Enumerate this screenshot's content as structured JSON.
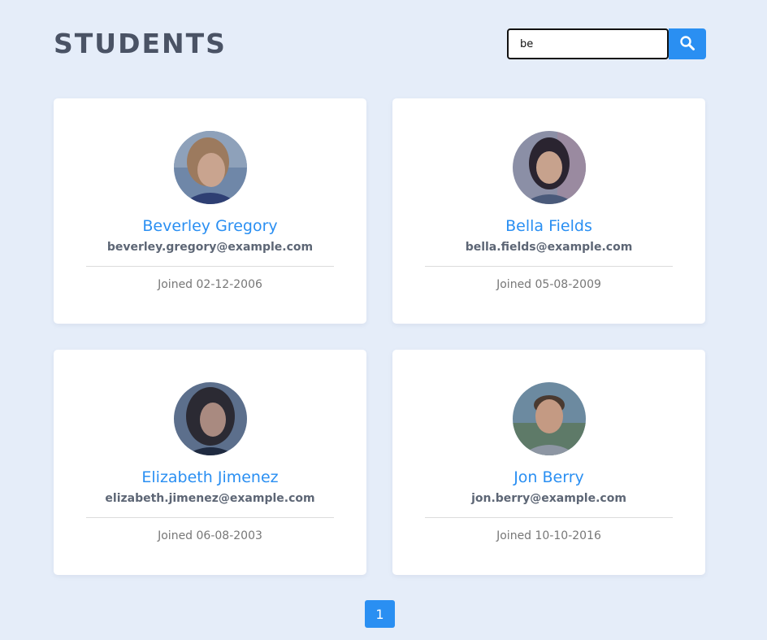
{
  "header": {
    "title": "STUDENTS"
  },
  "search": {
    "value": "be",
    "icon": "search-icon"
  },
  "students": [
    {
      "name": "Beverley Gregory",
      "email": "beverley.gregory@example.com",
      "joined": "Joined 02-12-2006"
    },
    {
      "name": "Bella Fields",
      "email": "bella.fields@example.com",
      "joined": "Joined 05-08-2009"
    },
    {
      "name": "Elizabeth Jimenez",
      "email": "elizabeth.jimenez@example.com",
      "joined": "Joined 06-08-2003"
    },
    {
      "name": "Jon Berry",
      "email": "jon.berry@example.com",
      "joined": "Joined 10-10-2016"
    }
  ],
  "pagination": {
    "pages": [
      "1"
    ],
    "current": "1"
  },
  "colors": {
    "accent": "#2a8ff2",
    "background": "#e5edf9",
    "title": "#4a5365"
  }
}
